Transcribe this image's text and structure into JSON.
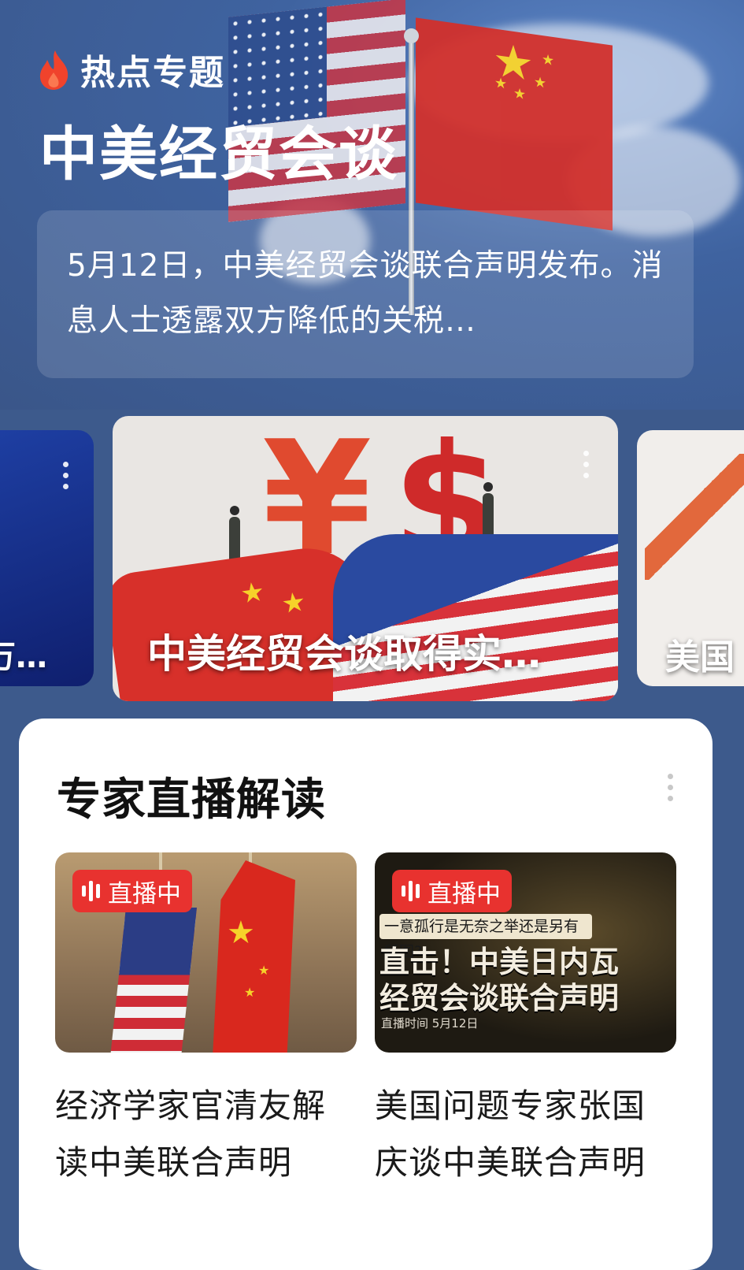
{
  "header": {
    "brand_icon": "fire-icon",
    "brand_label": "热点专题",
    "title": "中美经贸会谈",
    "summary": "5月12日，中美经贸会谈联合声明发布。消息人士透露双方降低的关税…"
  },
  "carousel": {
    "left_card": {
      "title": "万…"
    },
    "center_card": {
      "title": "中美经贸会谈取得实…"
    },
    "right_card": {
      "title": "美国"
    }
  },
  "expert_section": {
    "title": "专家直播解读",
    "items": [
      {
        "badge": "直播中",
        "caption": "经济学家官清友解读中美联合声明"
      },
      {
        "badge": "直播中",
        "caption": "美国问题专家张国庆谈中美联合声明",
        "thumb_subtitle": "一意孤行是无奈之举还是另有所图?",
        "thumb_headline_1": "直击！中美日内瓦",
        "thumb_headline_2": "经贸会谈联合声明",
        "thumb_date": "直播时间  5月12日"
      }
    ]
  },
  "colors": {
    "background": "#3d5a8c",
    "live_badge": "#e8322f",
    "brand_flame": "#f0432c"
  }
}
